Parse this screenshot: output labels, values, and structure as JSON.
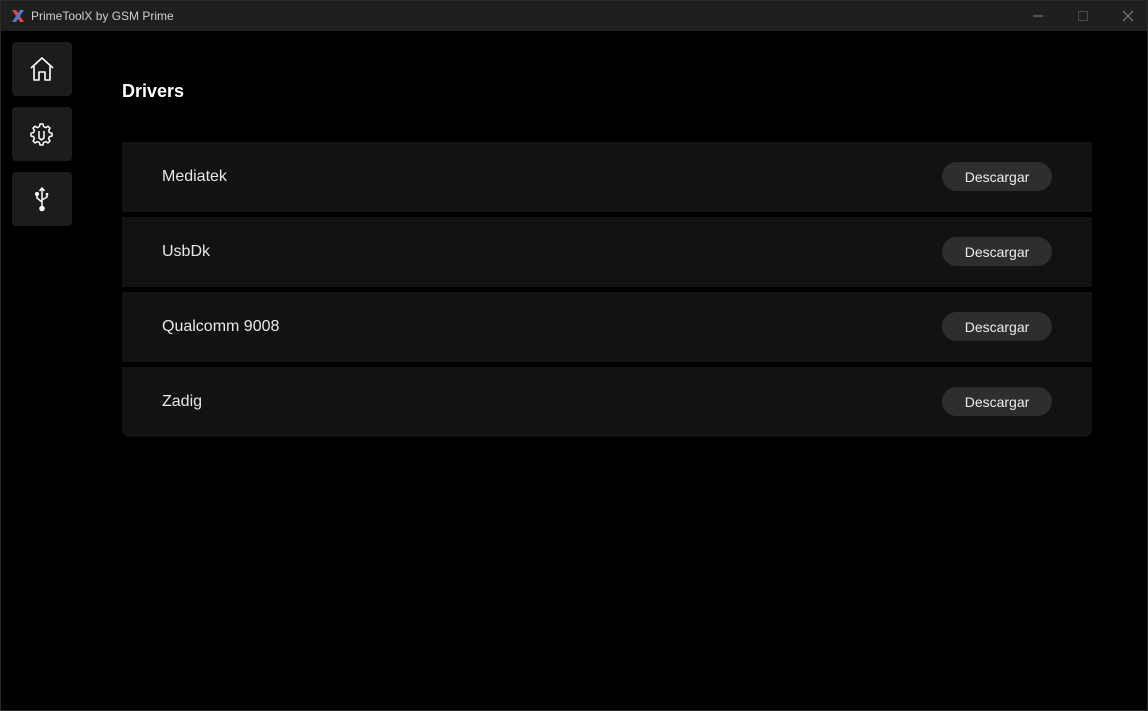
{
  "titlebar": {
    "title": "PrimeToolX by GSM Prime",
    "logo_icon": "x-logo-icon",
    "logo_colors": [
      "#e8433f",
      "#4a7bd6"
    ]
  },
  "sidebar": {
    "items": [
      {
        "id": "home",
        "icon": "home-icon"
      },
      {
        "id": "tools",
        "icon": "gear-wrench-icon"
      },
      {
        "id": "drivers",
        "icon": "usb-icon"
      }
    ]
  },
  "main": {
    "title": "Drivers",
    "drivers": [
      {
        "name": "Mediatek",
        "button": "Descargar"
      },
      {
        "name": "UsbDk",
        "button": "Descargar"
      },
      {
        "name": "Qualcomm 9008",
        "button": "Descargar"
      },
      {
        "name": "Zadig",
        "button": "Descargar"
      }
    ]
  },
  "colors": {
    "background": "#000000",
    "card": "#121212",
    "button": "#2e2e2e",
    "titlebar": "#1f1f1f"
  }
}
